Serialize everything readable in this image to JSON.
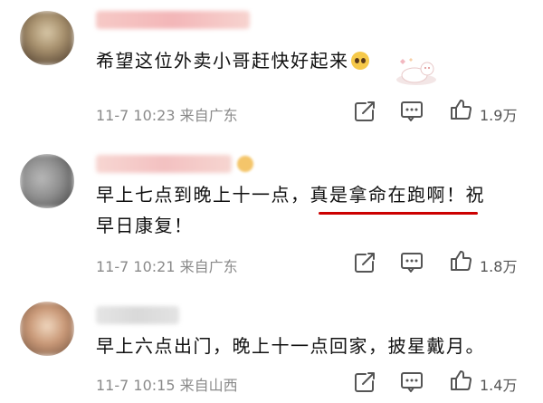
{
  "comments": [
    {
      "text": "希望这位外卖小哥赶快好起来",
      "emoji": "pleading-face-icon",
      "time": "11-7 10:23",
      "location": "来自广东",
      "likes": "1.9万"
    },
    {
      "text_line1_prefix": "早上七点到晚上十一点，",
      "text_line1_highlight": "真是拿命在跑啊！",
      "text_line1_suffix": "祝",
      "text_line2": "早日康复！",
      "time": "11-7 10:21",
      "location": "来自广东",
      "likes": "1.8万",
      "highlight_color": "#cc0000"
    },
    {
      "text": "早上六点出门，晚上十一点回家，披星戴月。",
      "time": "11-7 10:15",
      "location": "来自山西",
      "likes": "1.4万"
    }
  ],
  "icons": {
    "share": "share-icon",
    "comment": "comment-icon",
    "like": "thumbs-up-icon"
  }
}
